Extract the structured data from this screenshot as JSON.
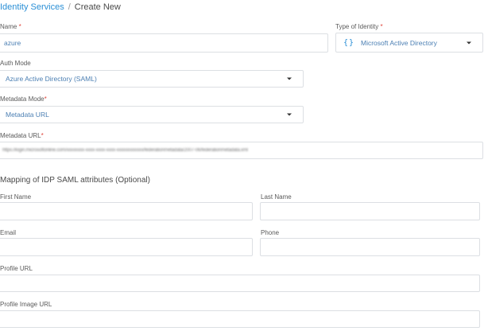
{
  "breadcrumb": {
    "parent": "Identity Services",
    "separator": "/",
    "current": "Create New"
  },
  "form": {
    "name": {
      "label": "Name",
      "required_mark": "*",
      "value": "azure"
    },
    "identity_type": {
      "label": "Type of Identity",
      "required_mark": "*",
      "icon": "curly-braces-icon",
      "icon_text": "{}",
      "value": "Microsoft Active Directory"
    },
    "auth_mode": {
      "label": "Auth Mode",
      "value": "Azure Active Directory (SAML)"
    },
    "metadata_mode": {
      "label": "Metadata Mode",
      "required_mark": "*",
      "value": "Metadata URL"
    },
    "metadata_url": {
      "label": "Metadata URL",
      "required_mark": "*",
      "value": "https://login.microsoftonline.com/xxxxxxxx-xxxx-xxxx-xxxx-xxxxxxxxxxxx/federationmetadata/2007-06/federationmetadata.xml"
    },
    "mapping": {
      "title": "Mapping of IDP SAML attributes (Optional)",
      "first_name": {
        "label": "First Name",
        "value": ""
      },
      "last_name": {
        "label": "Last Name",
        "value": ""
      },
      "email": {
        "label": "Email",
        "value": ""
      },
      "phone": {
        "label": "Phone",
        "value": ""
      },
      "profile_url": {
        "label": "Profile URL",
        "value": ""
      },
      "profile_image_url": {
        "label": "Profile Image URL",
        "value": ""
      }
    }
  },
  "colors": {
    "link": "#2a8fd6",
    "required": "#e0453b",
    "value_text": "#4b7fb3",
    "border": "#dcdfe3"
  }
}
